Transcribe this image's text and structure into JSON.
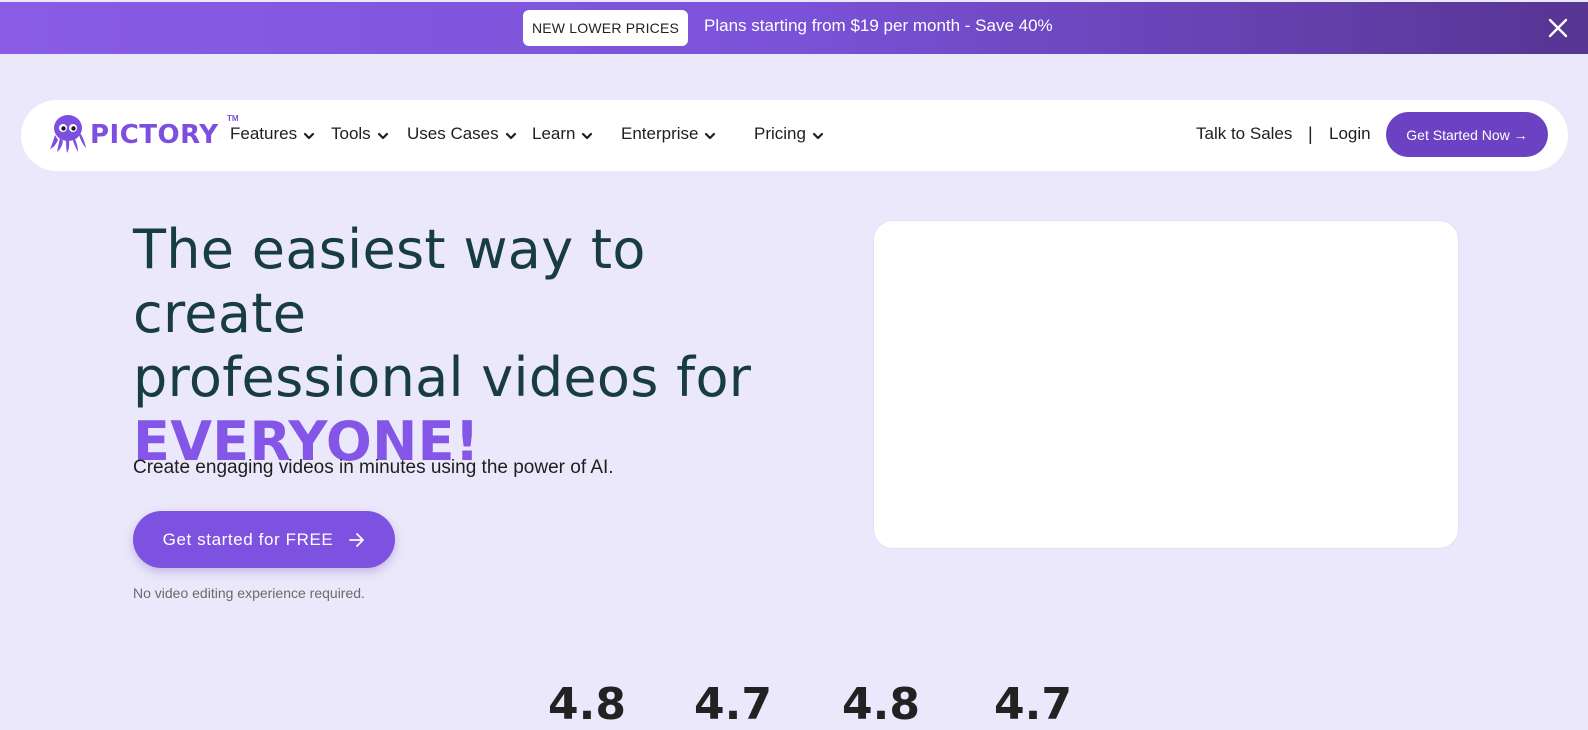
{
  "promo": {
    "badge": "NEW LOWER PRICES",
    "message": "Plans starting from $19 per month - Save 40%"
  },
  "nav": {
    "brand": "PICTORY",
    "trademark": "TM",
    "items": [
      {
        "label": "Features"
      },
      {
        "label": "Tools"
      },
      {
        "label": "Uses Cases"
      },
      {
        "label": "Learn"
      },
      {
        "label": "Enterprise"
      },
      {
        "label": "Pricing"
      }
    ],
    "talk_to_sales": "Talk to Sales",
    "separator": "|",
    "login": "Login",
    "cta": "Get Started Now →"
  },
  "hero": {
    "headline_line1": "The easiest way to create",
    "headline_line2": "professional videos for",
    "headline_accent": "EVERYONE!",
    "subtitle": "Create engaging videos in minutes using the power of AI.",
    "cta": "Get started for FREE",
    "note": "No video editing experience required."
  },
  "ratings": [
    "4.8",
    "4.7",
    "4.8",
    "4.7"
  ],
  "colors": {
    "brand_purple": "#7c4fe0",
    "nav_cta": "#6b42c1",
    "hero_cta": "#7e52e0",
    "headline": "#173c44",
    "page_bg": "#ece8fb"
  }
}
